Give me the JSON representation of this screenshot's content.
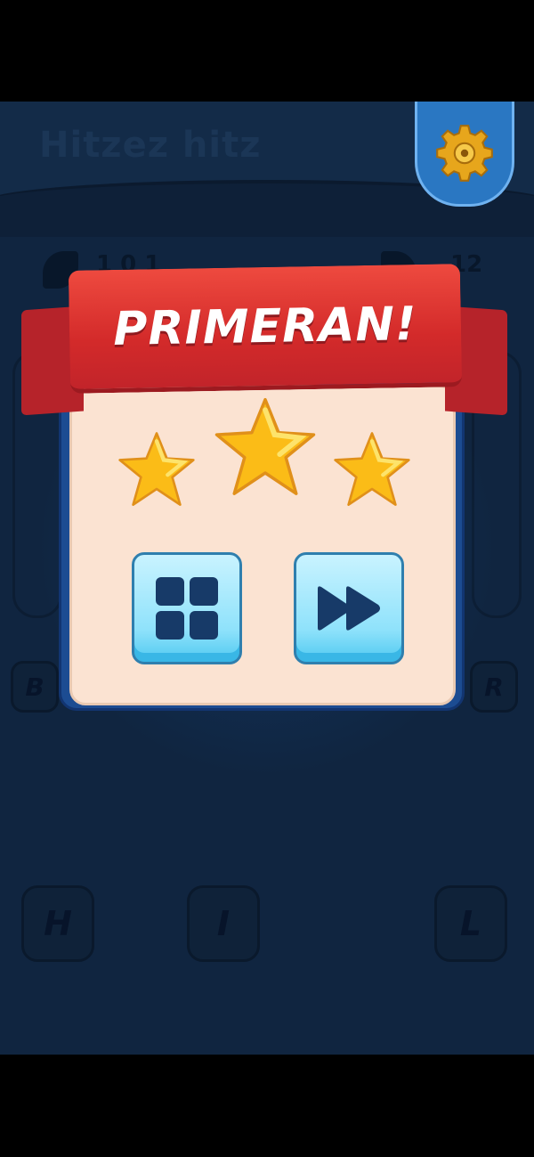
{
  "background": {
    "title": "Hitzez hitz",
    "progress_left": "1 0 1",
    "progress_right": "12",
    "tiles": {
      "row1": [
        "B",
        "R"
      ],
      "row2": [
        "H",
        "I",
        "L"
      ]
    }
  },
  "dialog": {
    "banner": "PRIMERAN!",
    "stars_earned": 3,
    "stars_total": 3,
    "menu_button_icon": "level-grid-icon",
    "next_button_icon": "fast-forward-icon"
  },
  "colors": {
    "background": "#102540",
    "settings_tab": "#2a77c2",
    "ribbon": "#d32a2a",
    "dialog_fill": "#fbe3d2",
    "dialog_frame": "#1c4c92",
    "button": "#8fe2fb",
    "star": "#fbbc17"
  },
  "icons": {
    "settings": "gear-icon"
  }
}
